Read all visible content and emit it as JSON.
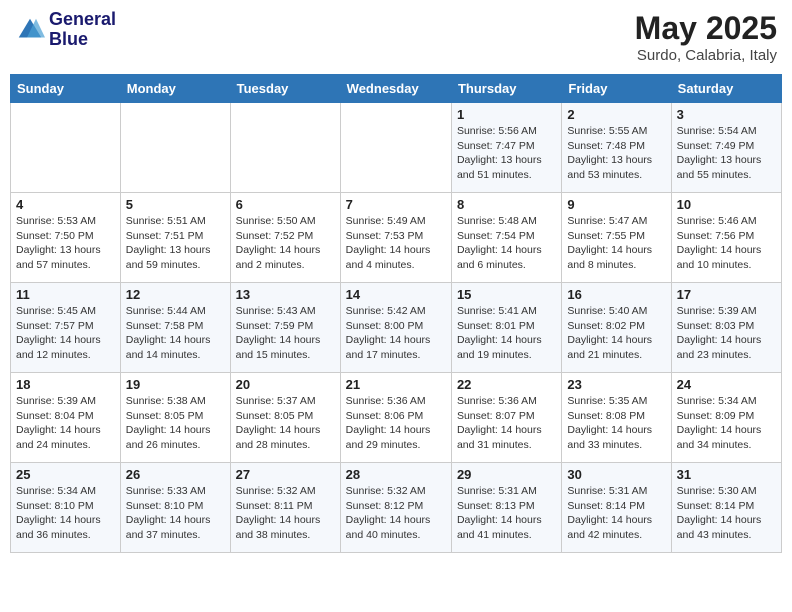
{
  "header": {
    "logo_line1": "General",
    "logo_line2": "Blue",
    "title": "May 2025",
    "subtitle": "Surdo, Calabria, Italy"
  },
  "calendar": {
    "days_of_week": [
      "Sunday",
      "Monday",
      "Tuesday",
      "Wednesday",
      "Thursday",
      "Friday",
      "Saturday"
    ],
    "weeks": [
      [
        {
          "day": "",
          "info": ""
        },
        {
          "day": "",
          "info": ""
        },
        {
          "day": "",
          "info": ""
        },
        {
          "day": "",
          "info": ""
        },
        {
          "day": "1",
          "info": "Sunrise: 5:56 AM\nSunset: 7:47 PM\nDaylight: 13 hours\nand 51 minutes."
        },
        {
          "day": "2",
          "info": "Sunrise: 5:55 AM\nSunset: 7:48 PM\nDaylight: 13 hours\nand 53 minutes."
        },
        {
          "day": "3",
          "info": "Sunrise: 5:54 AM\nSunset: 7:49 PM\nDaylight: 13 hours\nand 55 minutes."
        }
      ],
      [
        {
          "day": "4",
          "info": "Sunrise: 5:53 AM\nSunset: 7:50 PM\nDaylight: 13 hours\nand 57 minutes."
        },
        {
          "day": "5",
          "info": "Sunrise: 5:51 AM\nSunset: 7:51 PM\nDaylight: 13 hours\nand 59 minutes."
        },
        {
          "day": "6",
          "info": "Sunrise: 5:50 AM\nSunset: 7:52 PM\nDaylight: 14 hours\nand 2 minutes."
        },
        {
          "day": "7",
          "info": "Sunrise: 5:49 AM\nSunset: 7:53 PM\nDaylight: 14 hours\nand 4 minutes."
        },
        {
          "day": "8",
          "info": "Sunrise: 5:48 AM\nSunset: 7:54 PM\nDaylight: 14 hours\nand 6 minutes."
        },
        {
          "day": "9",
          "info": "Sunrise: 5:47 AM\nSunset: 7:55 PM\nDaylight: 14 hours\nand 8 minutes."
        },
        {
          "day": "10",
          "info": "Sunrise: 5:46 AM\nSunset: 7:56 PM\nDaylight: 14 hours\nand 10 minutes."
        }
      ],
      [
        {
          "day": "11",
          "info": "Sunrise: 5:45 AM\nSunset: 7:57 PM\nDaylight: 14 hours\nand 12 minutes."
        },
        {
          "day": "12",
          "info": "Sunrise: 5:44 AM\nSunset: 7:58 PM\nDaylight: 14 hours\nand 14 minutes."
        },
        {
          "day": "13",
          "info": "Sunrise: 5:43 AM\nSunset: 7:59 PM\nDaylight: 14 hours\nand 15 minutes."
        },
        {
          "day": "14",
          "info": "Sunrise: 5:42 AM\nSunset: 8:00 PM\nDaylight: 14 hours\nand 17 minutes."
        },
        {
          "day": "15",
          "info": "Sunrise: 5:41 AM\nSunset: 8:01 PM\nDaylight: 14 hours\nand 19 minutes."
        },
        {
          "day": "16",
          "info": "Sunrise: 5:40 AM\nSunset: 8:02 PM\nDaylight: 14 hours\nand 21 minutes."
        },
        {
          "day": "17",
          "info": "Sunrise: 5:39 AM\nSunset: 8:03 PM\nDaylight: 14 hours\nand 23 minutes."
        }
      ],
      [
        {
          "day": "18",
          "info": "Sunrise: 5:39 AM\nSunset: 8:04 PM\nDaylight: 14 hours\nand 24 minutes."
        },
        {
          "day": "19",
          "info": "Sunrise: 5:38 AM\nSunset: 8:05 PM\nDaylight: 14 hours\nand 26 minutes."
        },
        {
          "day": "20",
          "info": "Sunrise: 5:37 AM\nSunset: 8:05 PM\nDaylight: 14 hours\nand 28 minutes."
        },
        {
          "day": "21",
          "info": "Sunrise: 5:36 AM\nSunset: 8:06 PM\nDaylight: 14 hours\nand 29 minutes."
        },
        {
          "day": "22",
          "info": "Sunrise: 5:36 AM\nSunset: 8:07 PM\nDaylight: 14 hours\nand 31 minutes."
        },
        {
          "day": "23",
          "info": "Sunrise: 5:35 AM\nSunset: 8:08 PM\nDaylight: 14 hours\nand 33 minutes."
        },
        {
          "day": "24",
          "info": "Sunrise: 5:34 AM\nSunset: 8:09 PM\nDaylight: 14 hours\nand 34 minutes."
        }
      ],
      [
        {
          "day": "25",
          "info": "Sunrise: 5:34 AM\nSunset: 8:10 PM\nDaylight: 14 hours\nand 36 minutes."
        },
        {
          "day": "26",
          "info": "Sunrise: 5:33 AM\nSunset: 8:10 PM\nDaylight: 14 hours\nand 37 minutes."
        },
        {
          "day": "27",
          "info": "Sunrise: 5:32 AM\nSunset: 8:11 PM\nDaylight: 14 hours\nand 38 minutes."
        },
        {
          "day": "28",
          "info": "Sunrise: 5:32 AM\nSunset: 8:12 PM\nDaylight: 14 hours\nand 40 minutes."
        },
        {
          "day": "29",
          "info": "Sunrise: 5:31 AM\nSunset: 8:13 PM\nDaylight: 14 hours\nand 41 minutes."
        },
        {
          "day": "30",
          "info": "Sunrise: 5:31 AM\nSunset: 8:14 PM\nDaylight: 14 hours\nand 42 minutes."
        },
        {
          "day": "31",
          "info": "Sunrise: 5:30 AM\nSunset: 8:14 PM\nDaylight: 14 hours\nand 43 minutes."
        }
      ]
    ]
  }
}
